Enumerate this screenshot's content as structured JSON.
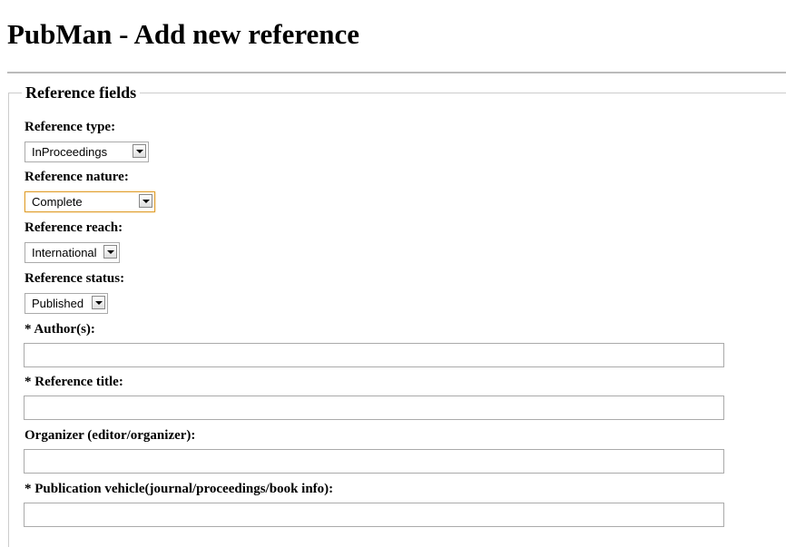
{
  "title": "PubMan - Add new reference",
  "legend": "Reference fields",
  "fields": {
    "type": {
      "label": "Reference type:",
      "value": "InProceedings"
    },
    "nature": {
      "label": "Reference nature:",
      "value": "Complete"
    },
    "reach": {
      "label": "Reference reach:",
      "value": "International"
    },
    "status": {
      "label": "Reference status:",
      "value": "Published"
    },
    "authors": {
      "label": "* Author(s):",
      "value": ""
    },
    "ref_title": {
      "label": "* Reference title:",
      "value": ""
    },
    "organizer": {
      "label": "Organizer (editor/organizer):",
      "value": ""
    },
    "vehicle": {
      "label": "* Publication vehicle(journal/proceedings/book info):",
      "value": ""
    }
  }
}
